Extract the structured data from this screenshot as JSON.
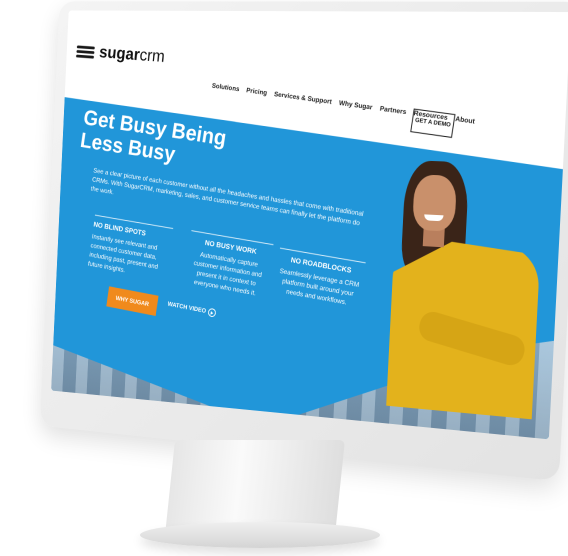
{
  "brand": {
    "logo_bold": "sugar",
    "logo_light": "crm"
  },
  "nav": {
    "links": [
      "Solutions",
      "Pricing",
      "Services & Support",
      "Why Sugar",
      "Partners",
      "Resources",
      "About"
    ],
    "cta": "GET A DEMO"
  },
  "hero": {
    "title_line1": "Get Busy Being",
    "title_line2": "Less Busy",
    "intro": "See a clear picture of each customer without all the headaches and hassles that come with traditional CRMs. With SugarCRM, marketing, sales, and customer service teams can finally let the platform do the work.",
    "columns": [
      {
        "heading": "NO BLIND SPOTS",
        "text": "Instantly see relevant and connected customer data, including past, present and future insights."
      },
      {
        "heading": "NO BUSY WORK",
        "text": "Automatically capture customer information and present it in context to everyone who needs it."
      },
      {
        "heading": "NO ROADBLOCKS",
        "text": "Seamlessly leverage a CRM platform built around your needs and workflows."
      }
    ],
    "primary_button": "WHY SUGAR",
    "secondary_link": "WATCH VIDEO"
  },
  "colors": {
    "hero_blue": "#2196d9",
    "cta_orange": "#f08a1c"
  }
}
